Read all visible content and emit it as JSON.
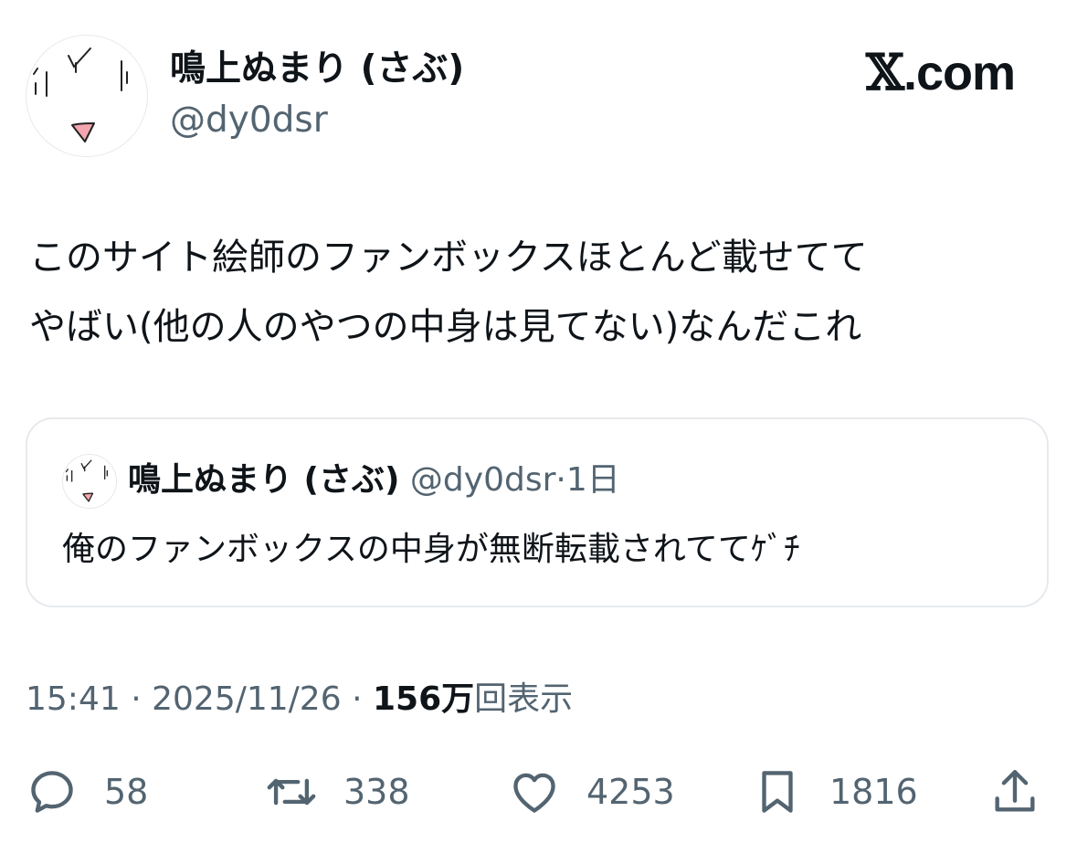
{
  "author": {
    "display_name": "鳴上ぬまり (さぶ)",
    "handle": "@dy0dsr",
    "avatar_icon": "avatar-face-icon"
  },
  "brand": {
    "x_mark": "𝕏",
    "suffix": ".com"
  },
  "tweet": {
    "lines": [
      "このサイト絵師のファンボックスほとんど載せてて",
      "やばい(他の人のやつの中身は見てない)なんだこれ"
    ]
  },
  "quote": {
    "display_name": "鳴上ぬまり (さぶ)",
    "handle": "@dy0dsr",
    "separator": "·",
    "time": "1日",
    "text": "俺のファンボックスの中身が無断転載されててｹﾞﾁ"
  },
  "meta": {
    "time": "15:41",
    "sep1": "·",
    "date": "2025/11/26",
    "sep2": "·",
    "views": "156万",
    "views_label": "回表示"
  },
  "actions": {
    "reply": {
      "icon": "reply-icon",
      "count": "58"
    },
    "retweet": {
      "icon": "retweet-icon",
      "count": "338"
    },
    "like": {
      "icon": "heart-icon",
      "count": "4253"
    },
    "bookmark": {
      "icon": "bookmark-icon",
      "count": "1816"
    },
    "share": {
      "icon": "share-icon"
    }
  },
  "colors": {
    "text_primary": "#0f1419",
    "text_secondary": "#536471",
    "border": "#e7eaed",
    "avatar_tongue": "#f4a6b0"
  }
}
